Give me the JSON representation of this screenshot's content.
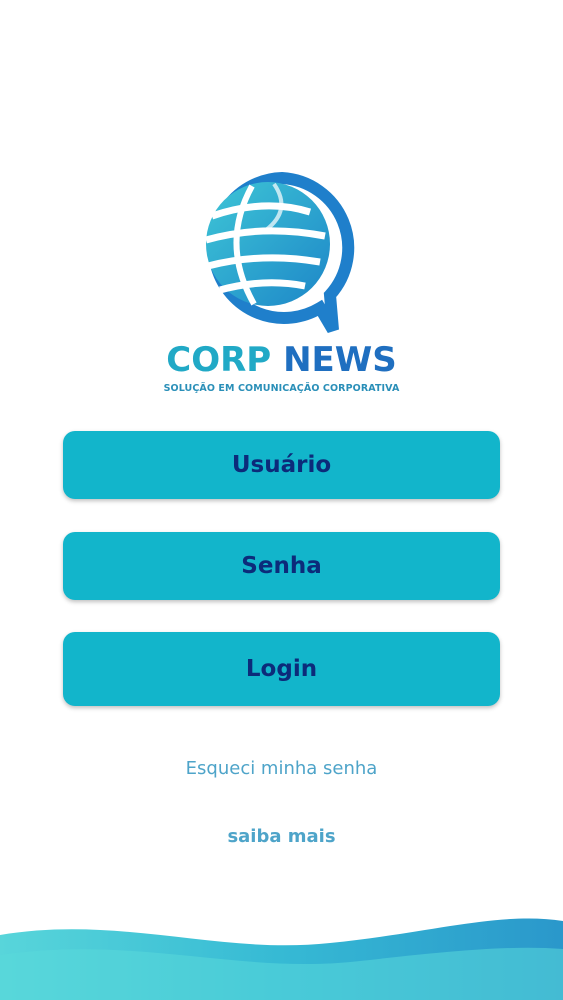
{
  "brand": {
    "title_part1": "CORP",
    "title_part2": "NEWS",
    "tagline": "SOLUÇÃO EM COMUNICAÇÃO CORPORATIVA"
  },
  "login_form": {
    "username_placeholder": "Usuário",
    "password_placeholder": "Senha",
    "submit_label": "Login"
  },
  "links": {
    "forgot_password": "Esqueci minha senha",
    "learn_more": "saiba mais"
  },
  "colors": {
    "button_fill": "#12b5cb",
    "button_text": "#0c2b7a",
    "link_text": "#4ea4c9",
    "brand_corp": "#21a9c6",
    "brand_news": "#1f6fc0"
  },
  "icons": {
    "logo": "globe-chat-bubble-logo"
  }
}
